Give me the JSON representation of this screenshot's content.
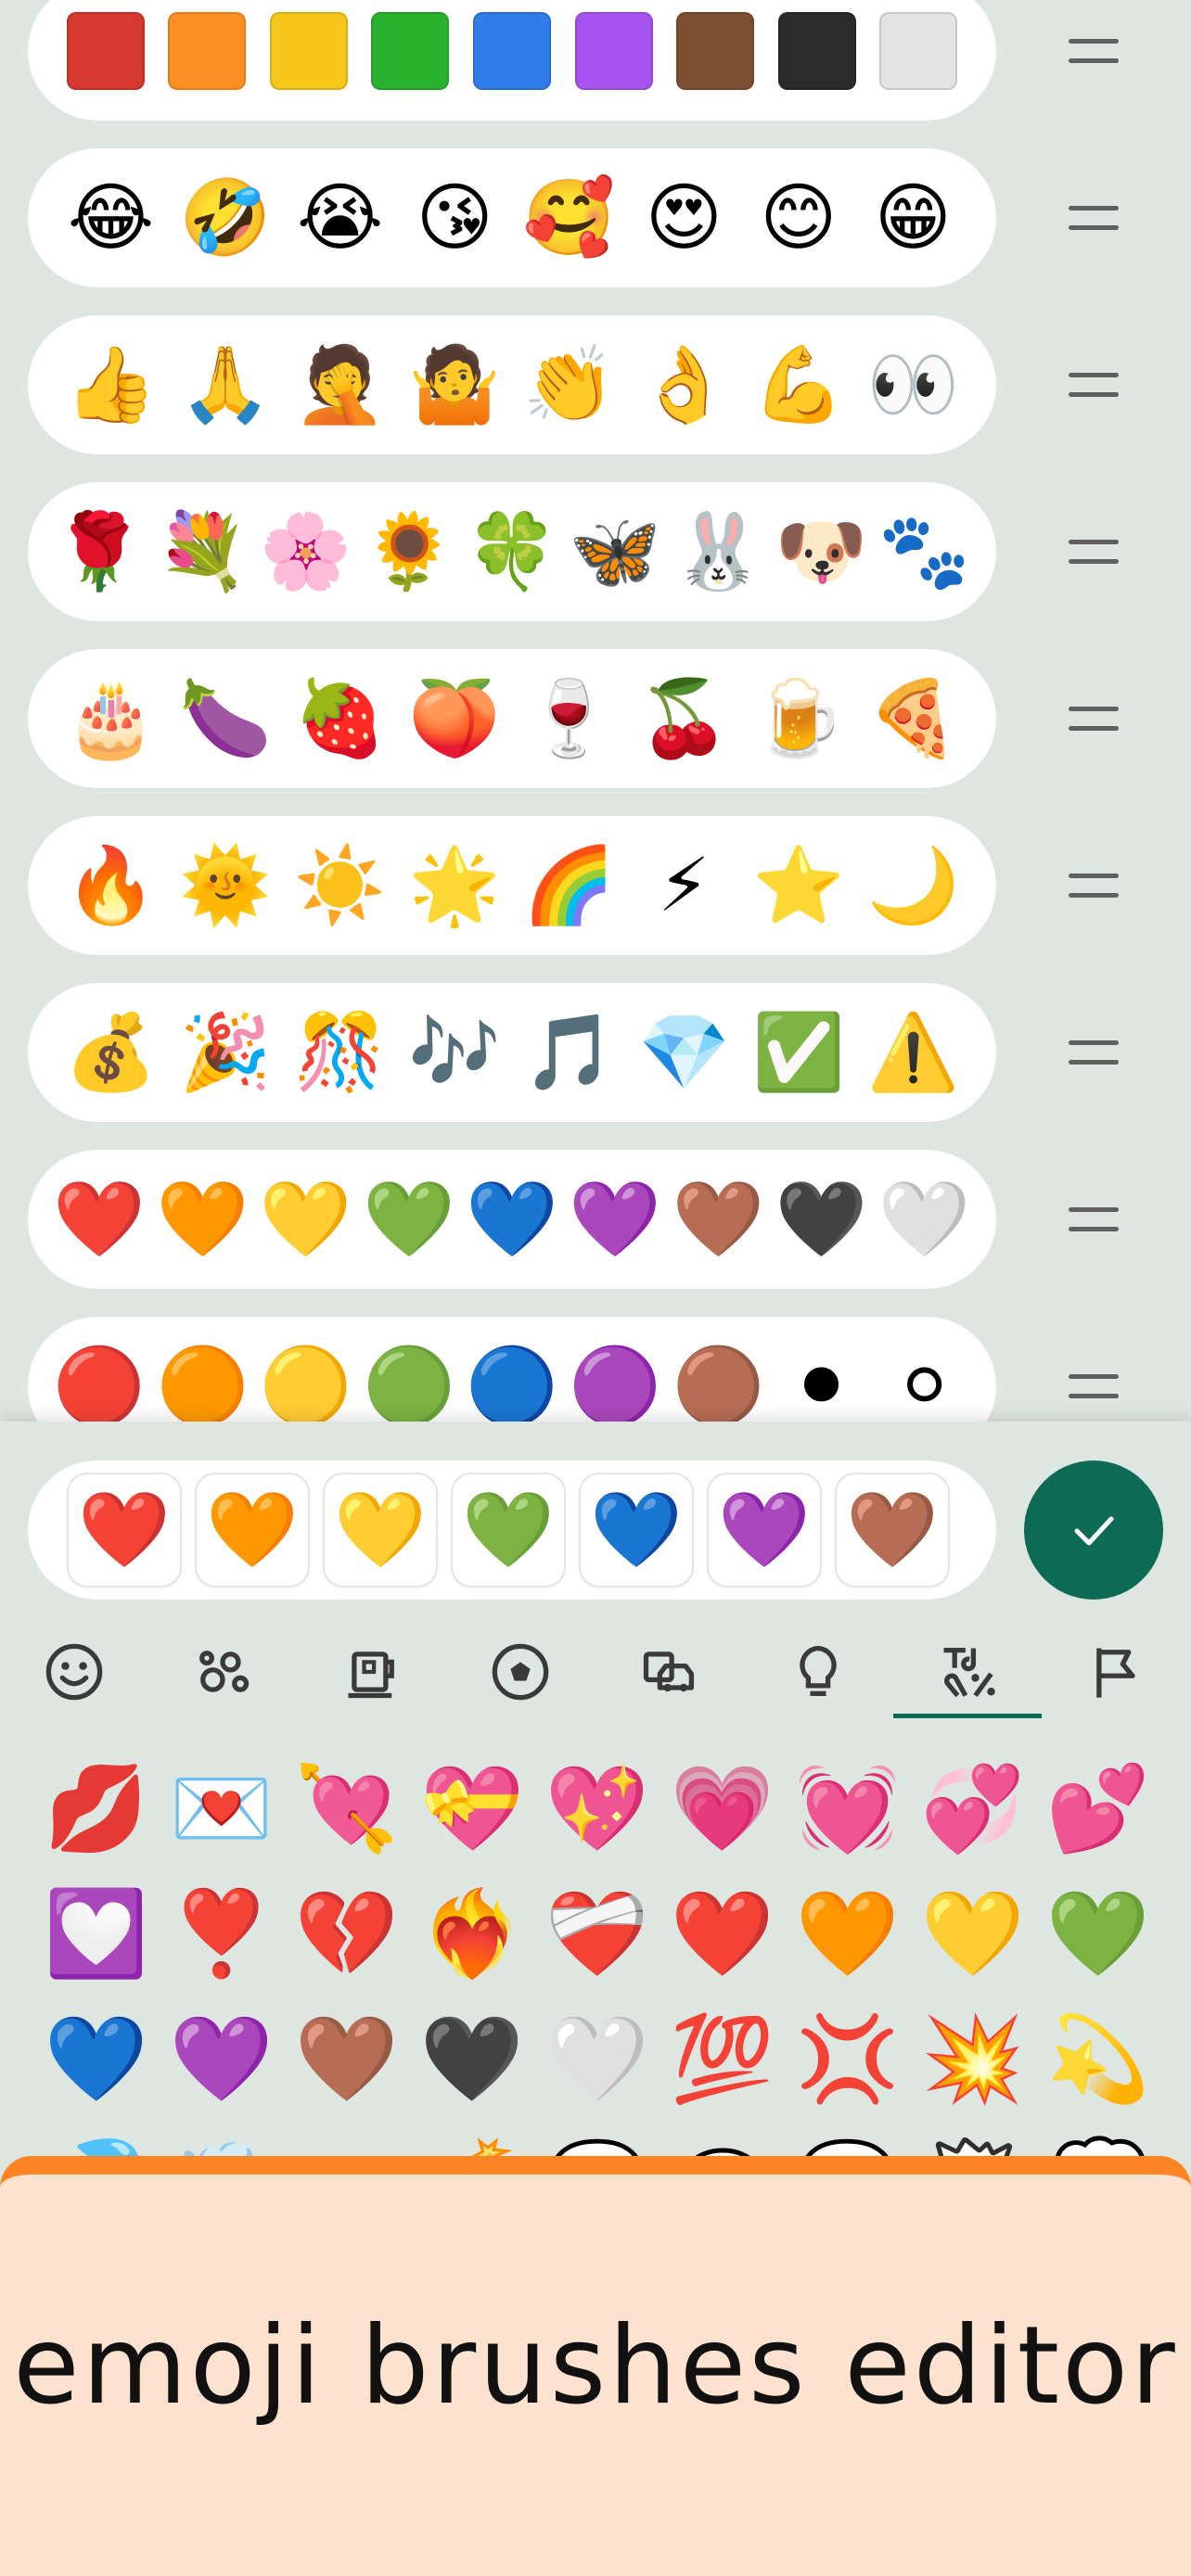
{
  "palettes": [
    {
      "kind": "swatch",
      "colors": [
        "#d63a2e",
        "#fb8f23",
        "#f6c61a",
        "#2ab22e",
        "#2f7de8",
        "#a753f0",
        "#7d4f31",
        "#2b2b2b",
        "#e3e3e3"
      ]
    },
    {
      "kind": "emoji",
      "items": [
        "😂",
        "🤣",
        "😭",
        "😘",
        "🥰",
        "😍",
        "😊",
        "😁"
      ]
    },
    {
      "kind": "emoji",
      "items": [
        "👍",
        "🙏",
        "🤦",
        "🤷",
        "👏",
        "👌",
        "💪",
        "👀"
      ]
    },
    {
      "kind": "emoji",
      "items": [
        "🌹",
        "💐",
        "🌸",
        "🌻",
        "🍀",
        "🦋",
        "🐰",
        "🐶",
        "🐾"
      ]
    },
    {
      "kind": "emoji",
      "items": [
        "🎂",
        "🍆",
        "🍓",
        "🍑",
        "🍷",
        "🍒",
        "🍺",
        "🍕"
      ]
    },
    {
      "kind": "emoji",
      "items": [
        "🔥",
        "🌞",
        "☀️",
        "🌟",
        "🌈",
        "⚡",
        "⭐",
        "🌙"
      ]
    },
    {
      "kind": "emoji",
      "items": [
        "💰",
        "🎉",
        "🎊",
        "🎶",
        "🎵",
        "💎",
        "✅",
        "⚠️"
      ]
    },
    {
      "kind": "emoji",
      "items": [
        "❤️",
        "🧡",
        "💛",
        "💚",
        "💙",
        "💜",
        "🤎",
        "🖤",
        "🤍"
      ]
    },
    {
      "kind": "emoji",
      "items": [
        "🔴",
        "🟠",
        "🟡",
        "🟢",
        "🔵",
        "🟣",
        "🟤",
        "⚫",
        "⚪"
      ]
    }
  ],
  "selected_brush": [
    "❤️",
    "🧡",
    "💛",
    "💚",
    "💙",
    "💜",
    "🤎"
  ],
  "categories": [
    {
      "name": "smileys",
      "icon": "smiley-icon"
    },
    {
      "name": "animals",
      "icon": "paw-icon"
    },
    {
      "name": "food",
      "icon": "cup-icon"
    },
    {
      "name": "activities",
      "icon": "ball-icon"
    },
    {
      "name": "travel",
      "icon": "car-icon"
    },
    {
      "name": "objects",
      "icon": "bulb-icon"
    },
    {
      "name": "symbols",
      "icon": "symbols-icon",
      "active": true
    },
    {
      "name": "flags",
      "icon": "flag-icon"
    }
  ],
  "emoji_grid": [
    [
      "💋",
      "💌",
      "💘",
      "💝",
      "💖",
      "💗",
      "💓",
      "💞",
      "💕"
    ],
    [
      "💟",
      "❣️",
      "💔",
      "❤️‍🔥",
      "❤️‍🩹",
      "❤️",
      "🧡",
      "💛",
      "💚"
    ],
    [
      "💙",
      "💜",
      "🤎",
      "🖤",
      "🤍",
      "💯",
      "💢",
      "💥",
      "💫"
    ],
    [
      "💦",
      "💨",
      "🕳️",
      "💣",
      "💬",
      "👁️‍🗨️",
      "🗨️",
      "🗯️",
      "💭"
    ]
  ],
  "banner": {
    "text": "emoji brushes editor"
  },
  "colors": {
    "accent": "#0d6a55",
    "banner_bg": "#fde2d0",
    "banner_border": "#ff8426",
    "background": "#dde6e1"
  }
}
